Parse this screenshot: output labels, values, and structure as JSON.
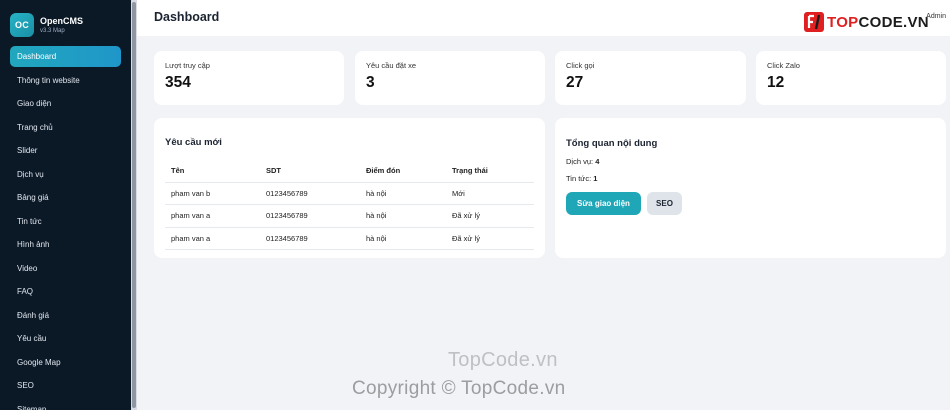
{
  "brand": {
    "logo_text": "OC",
    "name": "OpenCMS",
    "version": "v3.3 Map"
  },
  "sidebar": {
    "items": [
      {
        "label": "Dashboard",
        "active": true
      },
      {
        "label": "Thông tin website"
      },
      {
        "label": "Giao diện"
      },
      {
        "label": "Trang chủ"
      },
      {
        "label": "Slider"
      },
      {
        "label": "Dịch vụ"
      },
      {
        "label": "Bảng giá"
      },
      {
        "label": "Tin tức"
      },
      {
        "label": "Hình ảnh"
      },
      {
        "label": "Video"
      },
      {
        "label": "FAQ"
      },
      {
        "label": "Đánh giá"
      },
      {
        "label": "Yêu cầu"
      },
      {
        "label": "Google Map"
      },
      {
        "label": "SEO"
      },
      {
        "label": "Sitemap"
      }
    ]
  },
  "header": {
    "title": "Dashboard",
    "user": "Admin"
  },
  "watermark_logo": {
    "prefix": "TOP",
    "suffix": "CODE.VN"
  },
  "stats": [
    {
      "label": "Lượt truy cập",
      "value": "354"
    },
    {
      "label": "Yêu cầu đặt xe",
      "value": "3"
    },
    {
      "label": "Click gọi",
      "value": "27"
    },
    {
      "label": "Click Zalo",
      "value": "12"
    }
  ],
  "requests": {
    "title": "Yêu cầu mới",
    "columns": [
      "Tên",
      "SDT",
      "Điểm đón",
      "Trạng thái"
    ],
    "rows": [
      [
        "pham van b",
        "0123456789",
        "hà nội",
        "Mới"
      ],
      [
        "pham van a",
        "0123456789",
        "hà nội",
        "Đã xử lý"
      ],
      [
        "pham van a",
        "0123456789",
        "hà nội",
        "Đã xử lý"
      ]
    ]
  },
  "overview": {
    "title": "Tổng quan nội dung",
    "services_label": "Dịch vụ:",
    "services_count": "4",
    "news_label": "Tin tức:",
    "news_count": "1",
    "edit_theme_button": "Sửa giao diện",
    "seo_button": "SEO"
  },
  "watermarks": {
    "line1": "TopCode.vn",
    "line2": "Copyright © TopCode.vn"
  },
  "colors": {
    "sidebar_bg": "#0b1826",
    "accent": "#1fa7b8",
    "page_bg": "#f1f3f7",
    "brand_red": "#e02020"
  }
}
